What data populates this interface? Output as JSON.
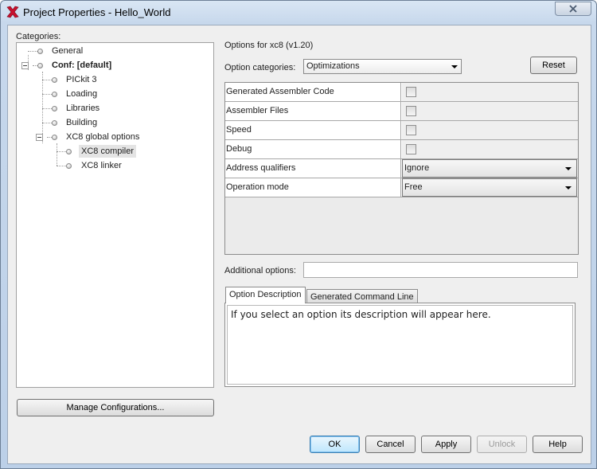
{
  "window": {
    "title": "Project Properties - Hello_World",
    "close_icon": "close-icon",
    "accent_color": "#3c7fb1"
  },
  "left": {
    "categories_label": "Categories:",
    "tree": [
      {
        "label": "General"
      },
      {
        "label": "Conf: [default]"
      },
      {
        "label": "PICkit 3"
      },
      {
        "label": "Loading"
      },
      {
        "label": "Libraries"
      },
      {
        "label": "Building"
      },
      {
        "label": "XC8 global options"
      },
      {
        "label": "XC8 compiler"
      },
      {
        "label": "XC8 linker"
      }
    ],
    "manage_configurations_label": "Manage Configurations..."
  },
  "right": {
    "options_header": "Options for xc8 (v1.20)",
    "option_categories_label": "Option categories:",
    "option_categories_value": "Optimizations",
    "reset_label": "Reset",
    "rows": [
      {
        "name": "Generated Assembler Code",
        "type": "checkbox",
        "checked": false
      },
      {
        "name": "Assembler Files",
        "type": "checkbox",
        "checked": false
      },
      {
        "name": "Speed",
        "type": "checkbox",
        "checked": false
      },
      {
        "name": "Debug",
        "type": "checkbox",
        "checked": false
      },
      {
        "name": "Address qualifiers",
        "type": "select",
        "value": "Ignore"
      },
      {
        "name": "Operation mode",
        "type": "select",
        "value": "Free"
      }
    ],
    "additional_options_label": "Additional options:",
    "additional_options_value": "",
    "tabs": [
      "Option Description",
      "Generated Command Line"
    ],
    "description_text": "If you select an option its description will appear here."
  },
  "footer": {
    "ok_label": "OK",
    "cancel_label": "Cancel",
    "apply_label": "Apply",
    "unlock_label": "Unlock",
    "help_label": "Help"
  }
}
